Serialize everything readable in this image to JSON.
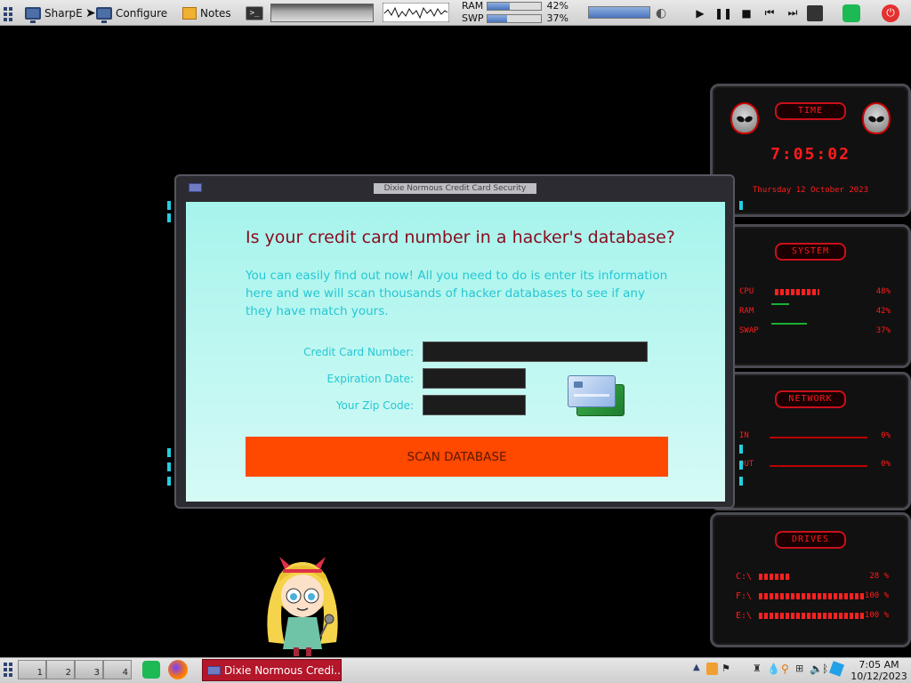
{
  "top_panel": {
    "launchers": [
      {
        "label": "SharpE"
      },
      {
        "label": "Configure"
      },
      {
        "label": "Notes"
      }
    ],
    "terminal_glyph": ">_",
    "ram": {
      "label": "RAM",
      "percent_text": "42%",
      "value": 42
    },
    "swp": {
      "label": "SWP",
      "percent_text": "37%",
      "value": 37
    },
    "volume_level": 100
  },
  "window": {
    "title": "Dixie Normous Credit Card Security",
    "headline": "Is your credit card number in a hacker's database?",
    "intro": "You can easily find out now! All you need to do is enter its information here and we will scan thousands of hacker databases to see if any they have match yours.",
    "fields": {
      "card_number": {
        "label": "Credit Card Number:",
        "value": ""
      },
      "expiration": {
        "label": "Expiration Date:",
        "value": ""
      },
      "zip": {
        "label": "Your Zip Code:",
        "value": ""
      }
    },
    "scan_button": "SCAN DATABASE"
  },
  "widgets": {
    "time": {
      "title": "TIME",
      "clock": "7:05:02",
      "date": "Thursday 12 October 2023"
    },
    "system": {
      "title": "SYSTEM",
      "rows": [
        {
          "label": "CPU",
          "value": "48%"
        },
        {
          "label": "RAM",
          "value": "42%"
        },
        {
          "label": "SWAP",
          "value": "37%"
        }
      ]
    },
    "network": {
      "title": "NETWORK",
      "rows": [
        {
          "label": "IN",
          "value": "0%"
        },
        {
          "label": "OUT",
          "value": "0%"
        }
      ]
    },
    "drives": {
      "title": "DRIVES",
      "rows": [
        {
          "label": "C:\\",
          "value": "28 %"
        },
        {
          "label": "F:\\",
          "value": "100 %"
        },
        {
          "label": "E:\\",
          "value": "100 %"
        }
      ]
    }
  },
  "bottom_panel": {
    "workspaces": [
      "1",
      "2",
      "3",
      "4"
    ],
    "task": "Dixie Normous Credi...",
    "clock_time": "7:05 AM",
    "clock_date": "10/12/2023"
  },
  "colors": {
    "accent_red": "#ff1c1c",
    "button_orange": "#ff4800",
    "heading": "#8a0b1e",
    "body_cyan": "#25c7d3"
  }
}
